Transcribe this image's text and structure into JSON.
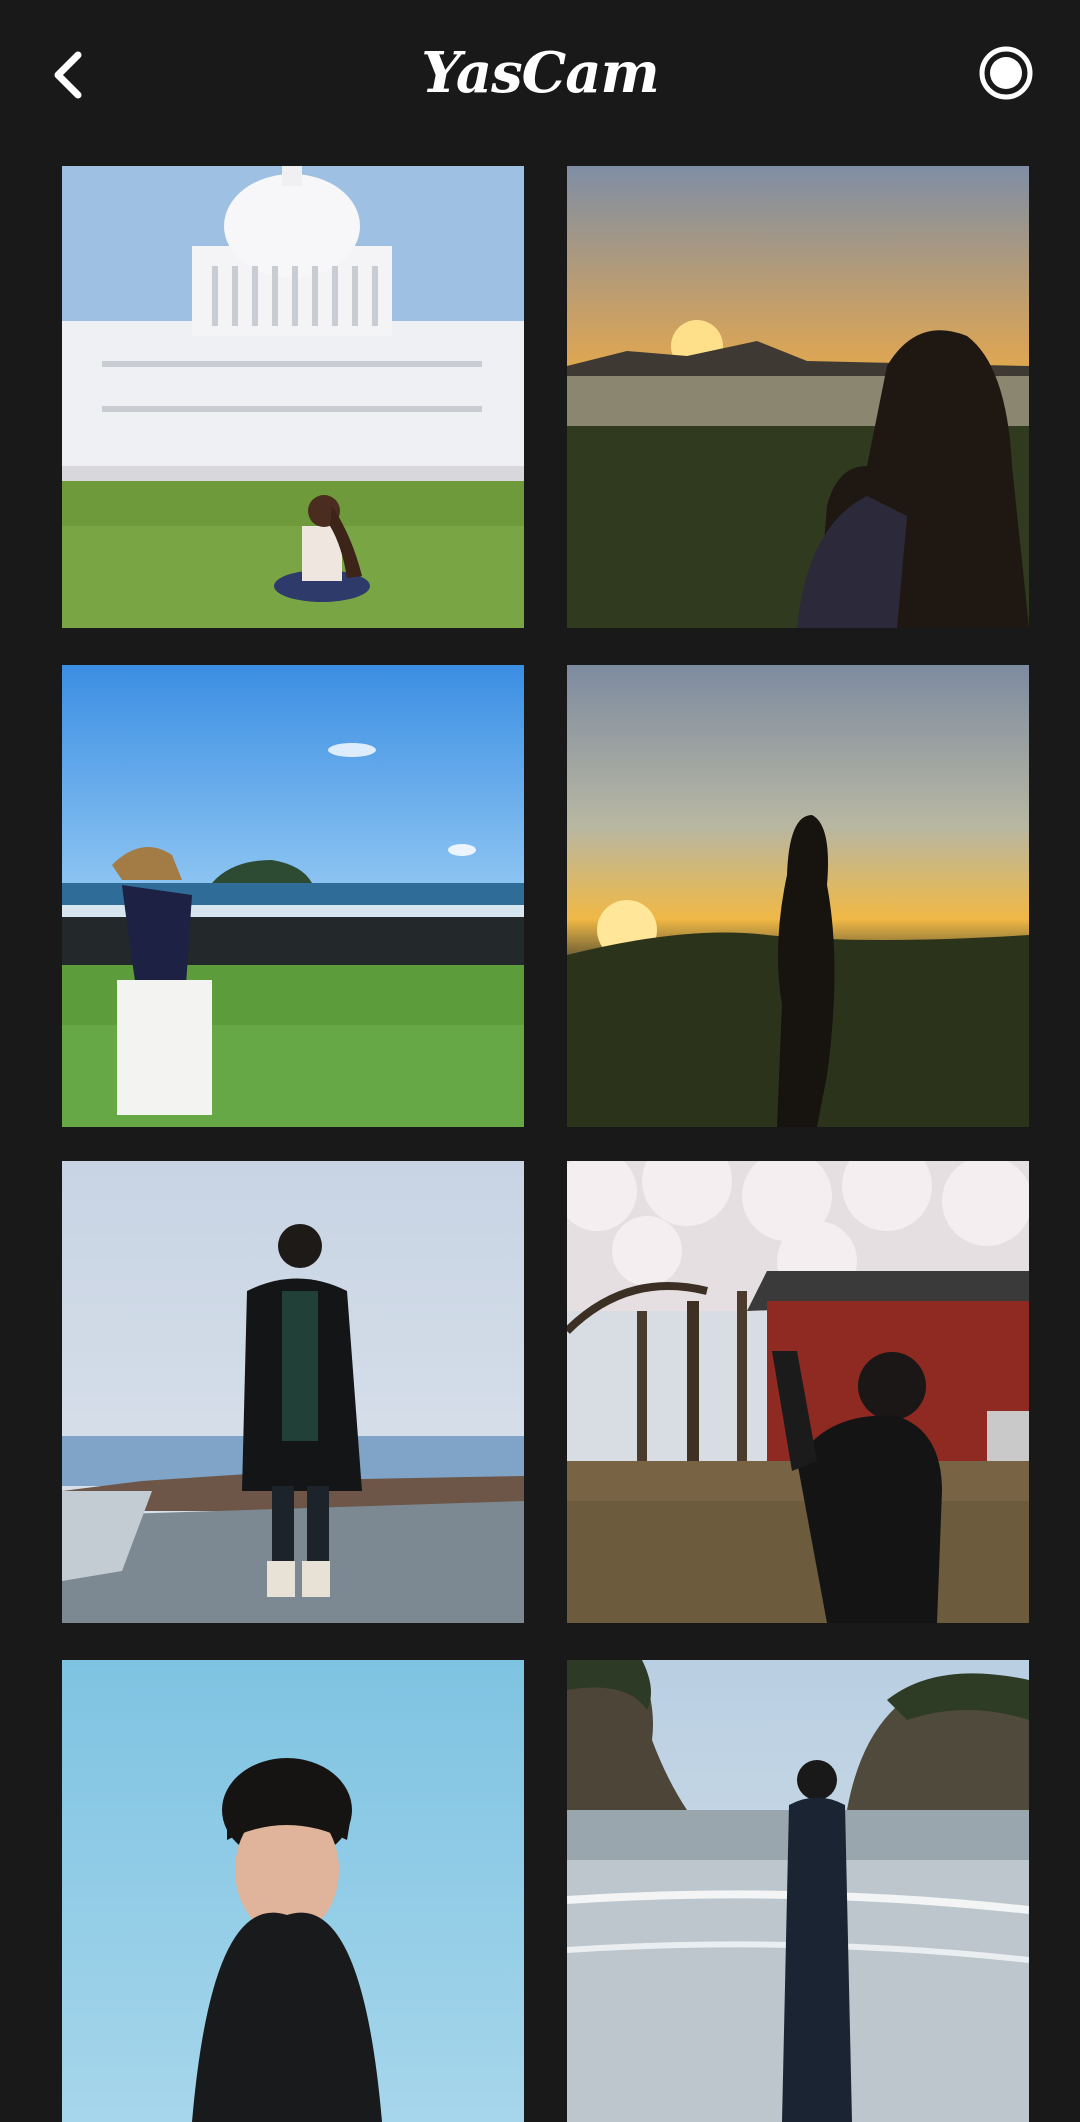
{
  "header": {
    "title": "YasCam",
    "back_icon": "chevron-left-icon",
    "record_icon": "record-icon"
  },
  "gallery": {
    "photos": [
      {
        "subject": "capitol-lawn"
      },
      {
        "subject": "sunset-lake"
      },
      {
        "subject": "coast-rocks"
      },
      {
        "subject": "sunset-field"
      },
      {
        "subject": "pier-man"
      },
      {
        "subject": "cherry-blossom"
      },
      {
        "subject": "portrait-sky"
      },
      {
        "subject": "beach-cliffs"
      }
    ]
  },
  "colors": {
    "background": "#191919",
    "title": "#ffffff"
  }
}
